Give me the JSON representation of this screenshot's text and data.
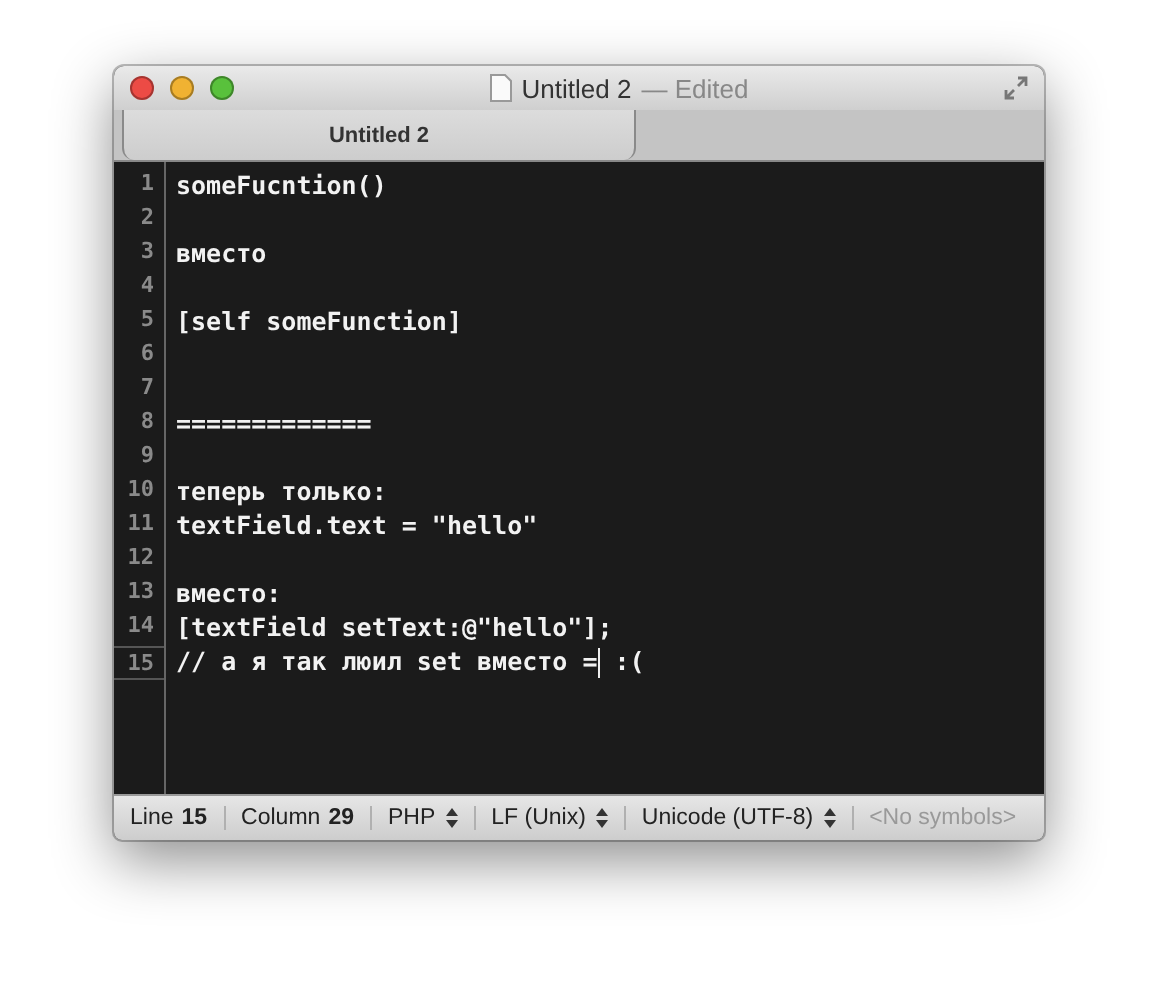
{
  "window": {
    "title": "Untitled 2",
    "edited": "— Edited"
  },
  "tabs": [
    {
      "label": "Untitled 2",
      "selected": true
    }
  ],
  "editor": {
    "lines": [
      {
        "number": "1",
        "text": "someFucntion()",
        "current": false
      },
      {
        "number": "2",
        "current": false
      },
      {
        "number": "3",
        "text": "вместо",
        "current": false
      },
      {
        "number": "4",
        "current": false
      },
      {
        "number": "5",
        "text": "[self someFunction]",
        "current": false
      },
      {
        "number": "6",
        "current": false
      },
      {
        "number": "7",
        "current": false
      },
      {
        "number": "8",
        "text": "=============",
        "current": false
      },
      {
        "number": "9",
        "current": false
      },
      {
        "number": "10",
        "text": "теперь только:",
        "current": false
      },
      {
        "number": "11",
        "text": "textField.text = \"hello\"",
        "current": false
      },
      {
        "number": "12",
        "current": false
      },
      {
        "number": "13",
        "text": "вместо:",
        "current": false
      },
      {
        "number": "14",
        "text": "[textField setText:@\"hello\"];",
        "current": false
      },
      {
        "number": "15",
        "text": "// а я так люил set вместо =",
        "text_after_cursor": " :(",
        "current": true
      }
    ]
  },
  "status_bar": [
    {
      "kind": "readout",
      "label": "Line",
      "value": "15"
    },
    {
      "kind": "readout",
      "label": "Column",
      "value": "29"
    },
    {
      "kind": "popup",
      "label": "PHP",
      "disabled": false
    },
    {
      "kind": "popup",
      "label": "LF (Unix)",
      "disabled": false
    },
    {
      "kind": "popup",
      "label": "Unicode (UTF-8)",
      "disabled": false
    },
    {
      "kind": "popup",
      "label": "<No symbols>",
      "disabled": true
    }
  ]
}
